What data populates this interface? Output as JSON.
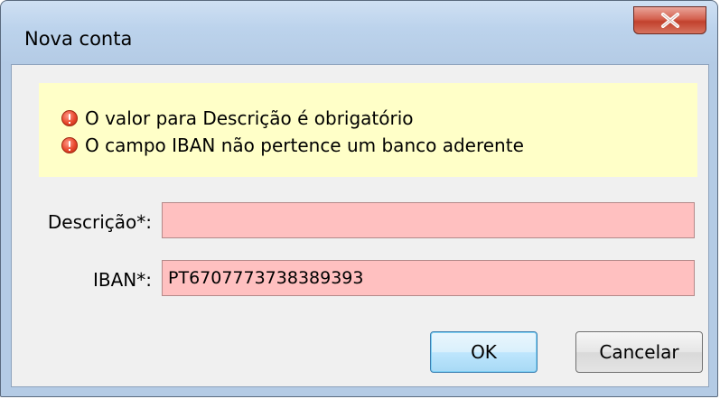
{
  "window": {
    "title": "Nova conta",
    "close_symbol": "close-icon"
  },
  "errors": [
    {
      "icon": "error-icon",
      "text": "O valor para Descrição é obrigatório"
    },
    {
      "icon": "error-icon",
      "text": "O campo IBAN não pertence um banco aderente"
    }
  ],
  "form": {
    "descricao": {
      "label": "Descrição*:",
      "value": ""
    },
    "iban": {
      "label": "IBAN*:",
      "value": "PT6707773738389393"
    }
  },
  "buttons": {
    "ok": "OK",
    "cancel": "Cancelar"
  },
  "colors": {
    "error_background": "#ffffc8",
    "invalid_field": "#ffc0c0",
    "close_button": "#c94b36"
  }
}
